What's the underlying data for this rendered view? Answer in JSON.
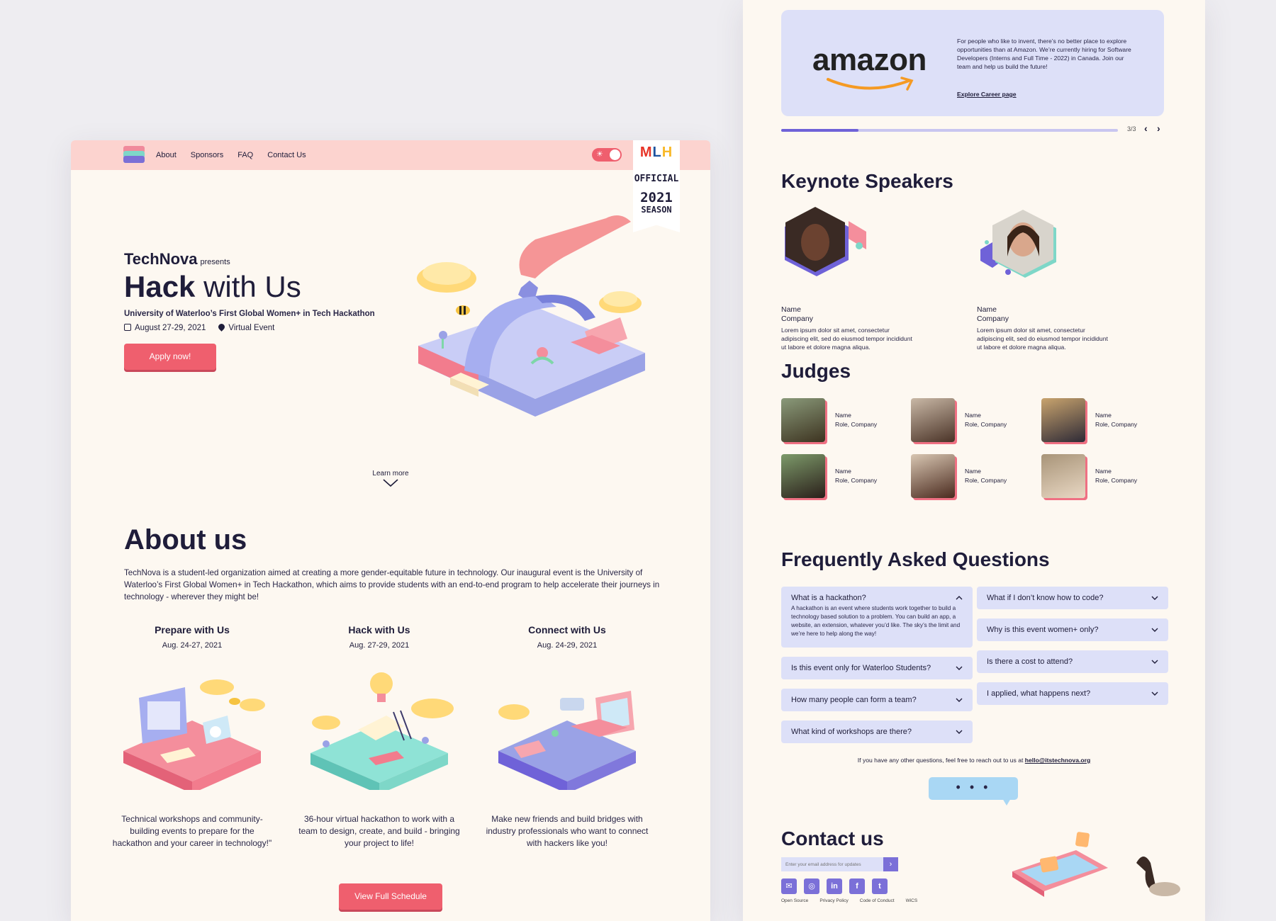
{
  "nav": {
    "links": [
      "About",
      "Sponsors",
      "FAQ",
      "Contact Us"
    ],
    "mlh": {
      "logo_m": "M",
      "logo_l": "L",
      "logo_h": "H",
      "official": "OFFICIAL",
      "year": "2021",
      "season": "SEASON"
    }
  },
  "hero": {
    "brand": "TechNova",
    "presents": "presents",
    "title_bold": "Hack",
    "title_rest": " with Us",
    "subtitle": "University of Waterloo’s First Global Women+ in Tech Hackathon",
    "date": "August 27-29, 2021",
    "location": "Virtual Event",
    "apply_label": "Apply now!",
    "learn_more": "Learn more"
  },
  "about": {
    "title": "About us",
    "text": "TechNova is a student-led organization aimed at creating a more gender-equitable future in technology. Our inaugural event is the University of Waterloo’s First Global Women+ in Tech Hackathon, which aims to provide students with an end-to-end program to help accelerate their journeys in technology - wherever they might be!",
    "columns": [
      {
        "title": "Prepare with Us",
        "date": "Aug. 24-27, 2021",
        "desc": "Technical workshops and community-building events to prepare for the hackathon and your career in technology!\""
      },
      {
        "title": "Hack with Us",
        "date": "Aug. 27-29, 2021",
        "desc": "36-hour virtual hackathon to work with a team to design, create, and build - bringing your project to life!"
      },
      {
        "title": "Connect with Us",
        "date": "Aug. 24-29, 2021",
        "desc": "Make new friends and build bridges with industry professionals who want to connect with hackers like you!"
      }
    ],
    "schedule_label": "View Full Schedule"
  },
  "sponsor": {
    "name": "amazon",
    "text": "For people who like to invent, there’s no better place to explore opportunities than at Amazon. We’re currently hiring for Software Developers (Interns and Full Time - 2022) in Canada. Join our team and help us build the future!",
    "link": "Explore Career page",
    "pager": "3/3",
    "progress": 0.23
  },
  "keynote": {
    "title": "Keynote Speakers",
    "speakers": [
      {
        "name": "Name",
        "company": "Company",
        "bio": "Lorem ipsum dolor sit amet, consectetur adipiscing elit, sed do eiusmod tempor incididunt ut labore et dolore magna aliqua."
      },
      {
        "name": "Name",
        "company": "Company",
        "bio": "Lorem ipsum dolor sit amet, consectetur adipiscing elit, sed do eiusmod tempor incididunt ut labore et dolore magna aliqua."
      }
    ]
  },
  "judges": {
    "title": "Judges",
    "items": [
      {
        "name": "Name",
        "role": "Role, Company"
      },
      {
        "name": "Name",
        "role": "Role, Company"
      },
      {
        "name": "Name",
        "role": "Role, Company"
      },
      {
        "name": "Name",
        "role": "Role, Company"
      },
      {
        "name": "Name",
        "role": "Role, Company"
      },
      {
        "name": "Name",
        "role": "Role, Company"
      }
    ]
  },
  "faq": {
    "title": "Frequently Asked Questions",
    "items": [
      {
        "q": "What is a hackathon?",
        "a": "A hackathon is an event where students work together to build a technology based solution to a problem. You can build an app, a website, an extension, whatever you’d like. The sky’s the limit and we’re here to help along the way!"
      },
      {
        "q": "Is this event only for Waterloo Students?"
      },
      {
        "q": "How many people can form a team?"
      },
      {
        "q": "What kind of workshops are there?"
      },
      {
        "q": "What if I don’t know how to code?"
      },
      {
        "q": "Why is this event women+ only?"
      },
      {
        "q": "Is there a cost to attend?"
      },
      {
        "q": "I applied, what happens next?"
      }
    ],
    "contact_prefix": "If you have any other questions, feel free to reach out to us at ",
    "contact_email": "hello@itstechnova.org",
    "chat_dots": "• • •"
  },
  "contact": {
    "title": "Contact us",
    "email_placeholder": "Enter your email address for updates",
    "submit": "›",
    "socials": [
      "✉",
      "◎",
      "in",
      "f",
      "t"
    ],
    "footer_links": [
      "Open Source",
      "Privacy Policy",
      "Code of Conduct",
      "WiCS"
    ]
  },
  "colors": {
    "accent": "#ef5f6e",
    "purple": "#7b70d8",
    "lavender": "#dde0f8",
    "cream": "#fdf8f1",
    "nav": "#fcd3cf"
  }
}
